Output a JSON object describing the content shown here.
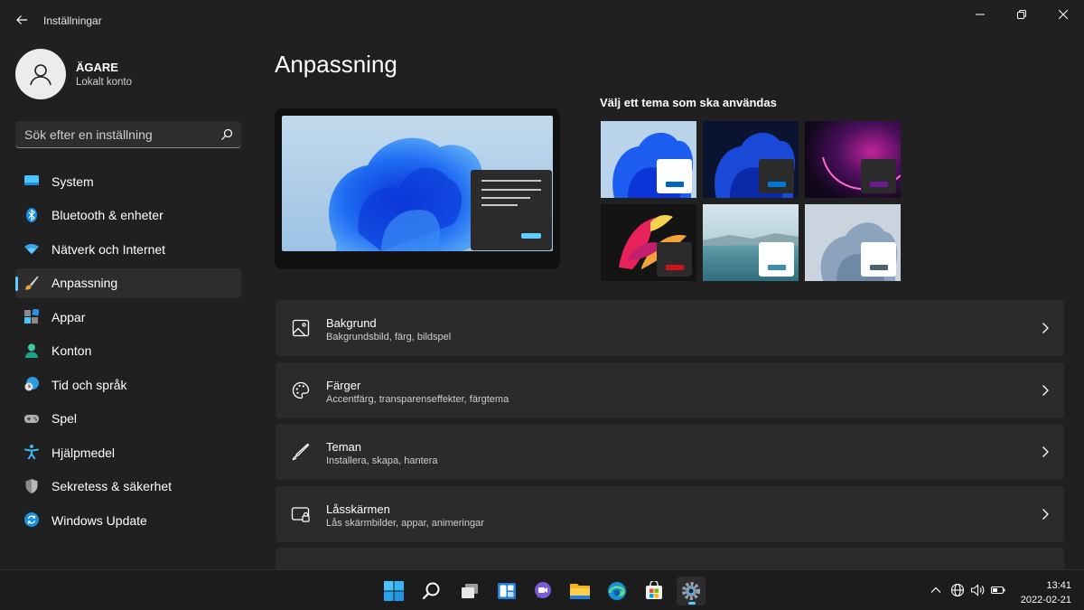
{
  "window": {
    "title": "Inställningar"
  },
  "profile": {
    "name": "ÄGARE",
    "account_type": "Lokalt konto"
  },
  "search": {
    "placeholder": "Sök efter en inställning"
  },
  "sidebar": {
    "items": [
      {
        "label": "System",
        "icon": "system-icon",
        "active": false
      },
      {
        "label": "Bluetooth & enheter",
        "icon": "bluetooth-icon",
        "active": false
      },
      {
        "label": "Nätverk och Internet",
        "icon": "wifi-icon",
        "active": false
      },
      {
        "label": "Anpassning",
        "icon": "brush-icon",
        "active": true
      },
      {
        "label": "Appar",
        "icon": "apps-icon",
        "active": false
      },
      {
        "label": "Konton",
        "icon": "person-icon",
        "active": false
      },
      {
        "label": "Tid och språk",
        "icon": "clock-globe-icon",
        "active": false
      },
      {
        "label": "Spel",
        "icon": "gamepad-icon",
        "active": false
      },
      {
        "label": "Hjälpmedel",
        "icon": "accessibility-icon",
        "active": false
      },
      {
        "label": "Sekretess & säkerhet",
        "icon": "shield-icon",
        "active": false
      },
      {
        "label": "Windows Update",
        "icon": "update-icon",
        "active": false
      }
    ]
  },
  "main": {
    "title": "Anpassning",
    "themes_title": "Välj ett tema som ska användas",
    "themes": [
      {
        "name": "theme-windows-light",
        "accent": "#0067c0",
        "window": "#ffffff"
      },
      {
        "name": "theme-windows-dark",
        "accent": "#0078d4",
        "window": "#2b2b2b"
      },
      {
        "name": "theme-glow",
        "accent": "#6b1a8f",
        "window": "#2b2b2b"
      },
      {
        "name": "theme-captured-motion",
        "accent": "#d1141b",
        "window": "#2b2b2b"
      },
      {
        "name": "theme-sunrise",
        "accent": "#3d8ea8",
        "window": "#ffffff"
      },
      {
        "name": "theme-flow",
        "accent": "#4d6170",
        "window": "#ffffff"
      }
    ],
    "cards": [
      {
        "title": "Bakgrund",
        "subtitle": "Bakgrundsbild, färg, bildspel",
        "icon": "image-icon"
      },
      {
        "title": "Färger",
        "subtitle": "Accentfärg, transparenseffekter, färgtema",
        "icon": "palette-icon"
      },
      {
        "title": "Teman",
        "subtitle": "Installera, skapa, hantera",
        "icon": "pen-icon"
      },
      {
        "title": "Låsskärmen",
        "subtitle": "Lås skärmbilder, appar, animeringar",
        "icon": "lockscreen-icon"
      }
    ]
  },
  "taskbar": {
    "time": "13:41",
    "date": "2022-02-21"
  },
  "colors": {
    "accent": "#60cdff",
    "background": "#202020",
    "card": "#2b2b2b",
    "active_item": "#2d2d2d"
  }
}
